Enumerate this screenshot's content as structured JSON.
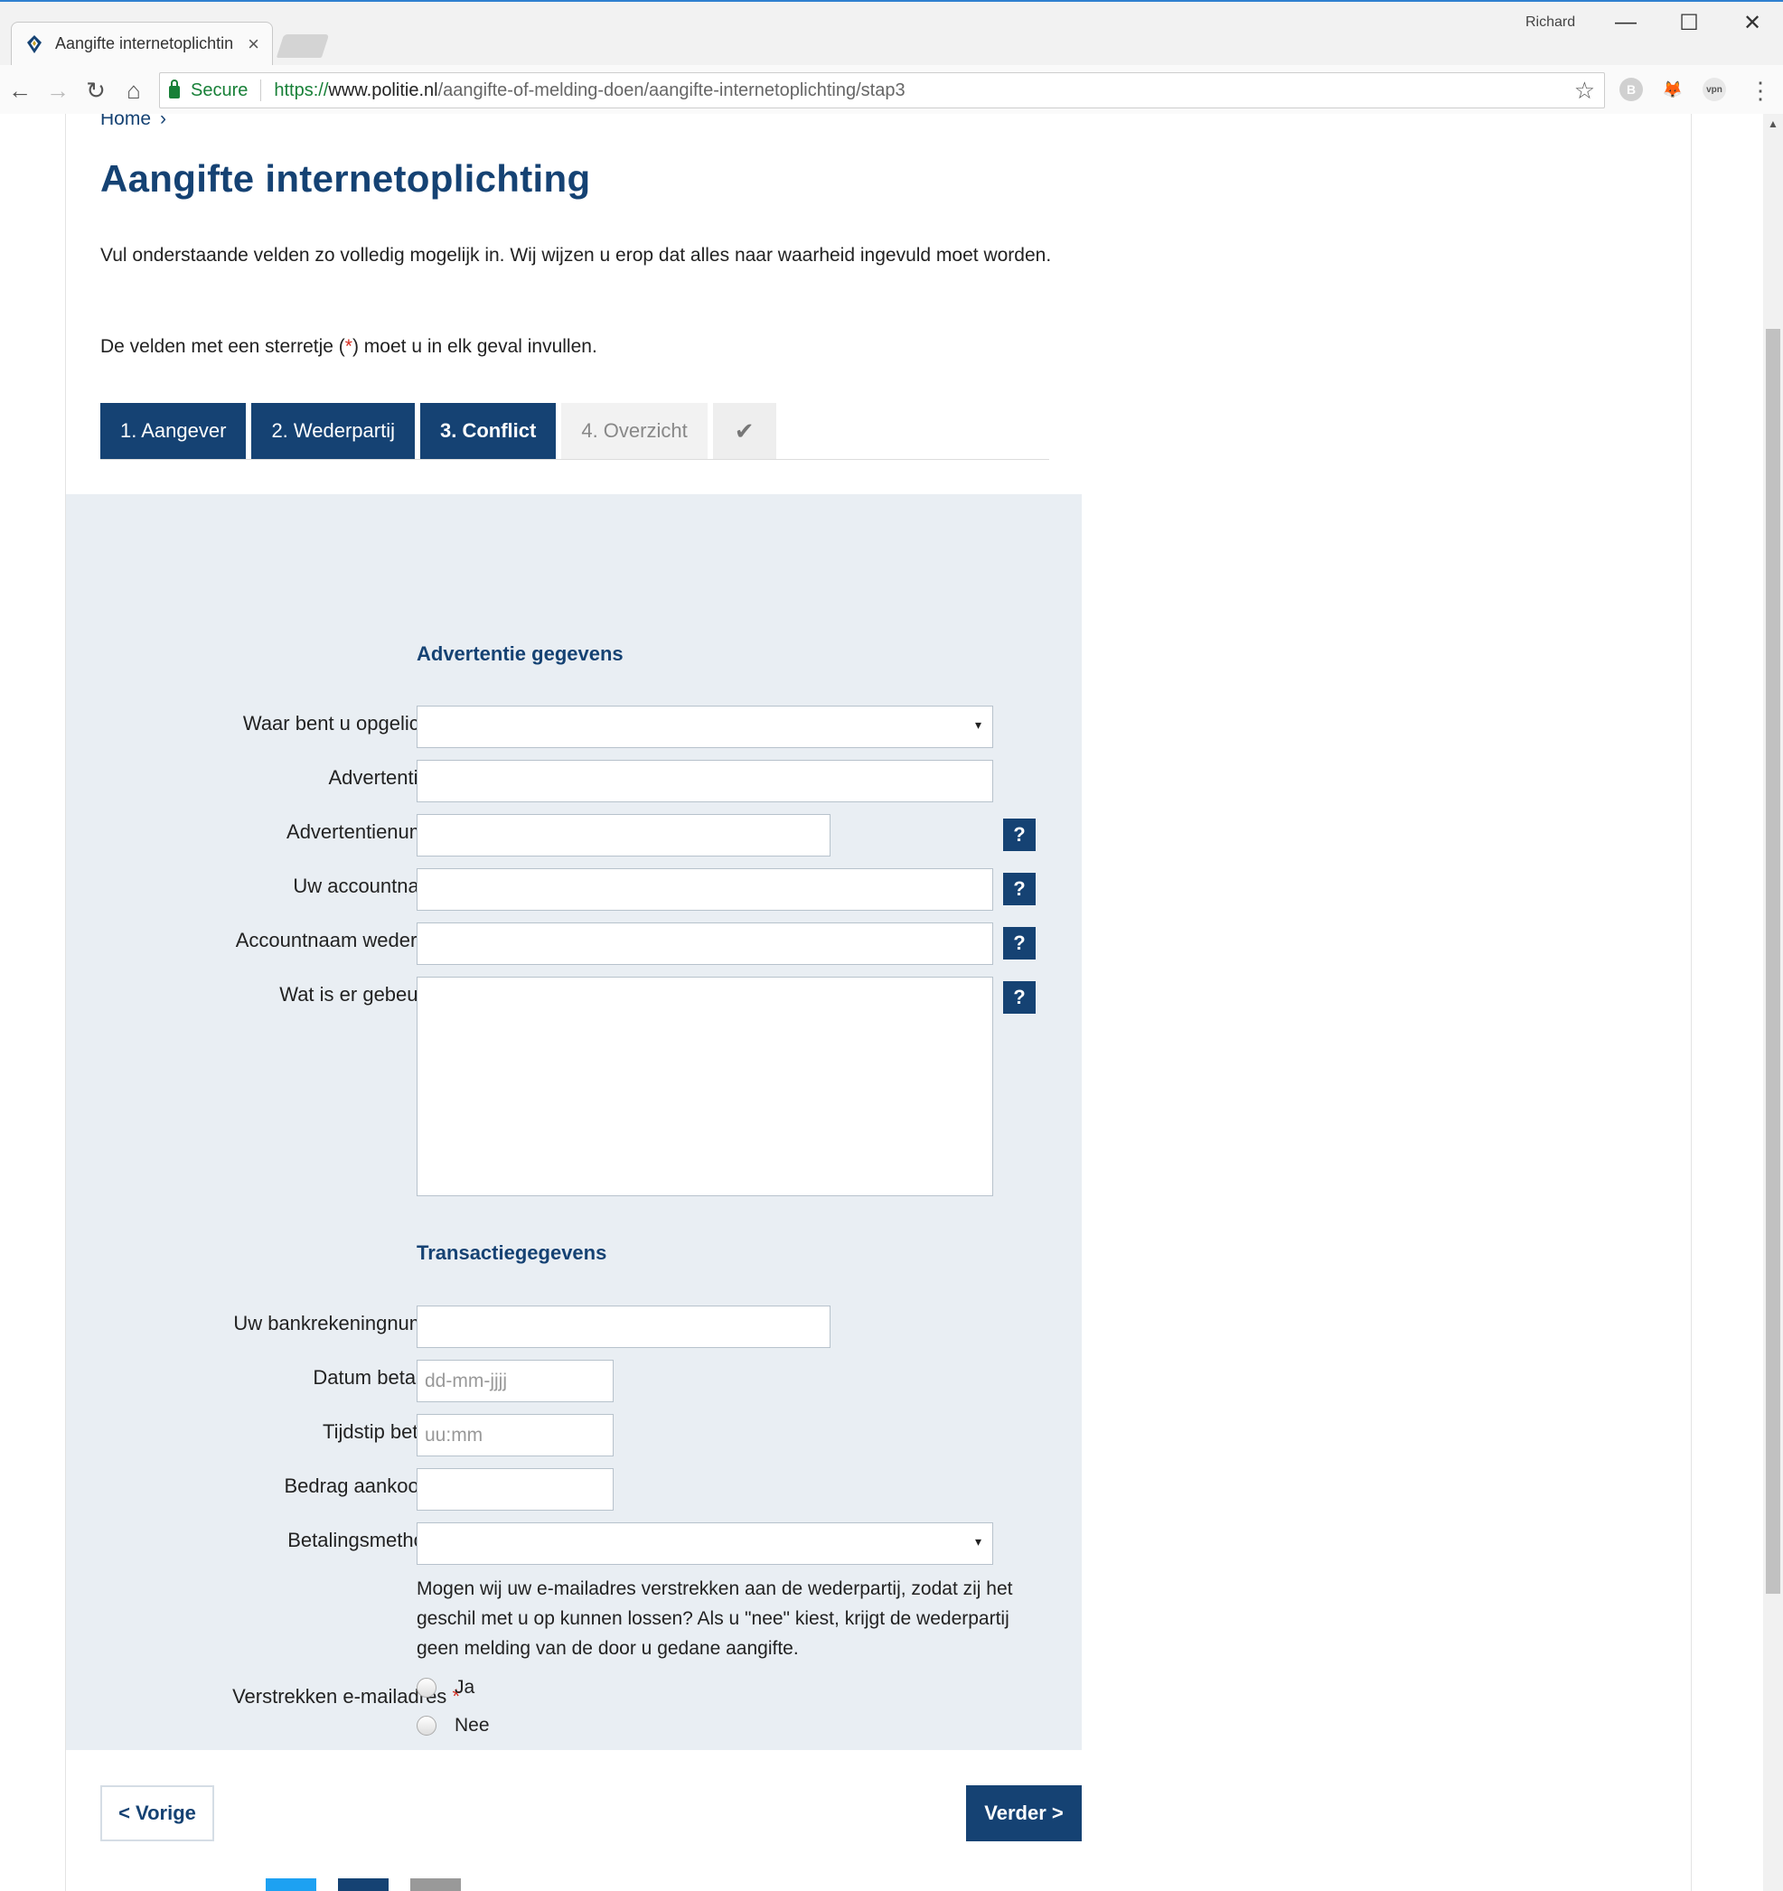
{
  "browser": {
    "tab_title": "Aangifte internetoplichtin",
    "tab_close": "×",
    "profile_name": "Richard",
    "window_controls": {
      "minimize": "—",
      "maximize": "☐",
      "close": "✕"
    },
    "nav": {
      "back": "←",
      "forward": "→",
      "reload": "↻",
      "home": "⌂"
    },
    "secure_label": "Secure",
    "url": {
      "scheme": "https://",
      "host": "www.politie.nl",
      "path": "/aangifte-of-melding-doen/aangifte-internetoplichting/stap3"
    },
    "bookmark_star": "☆",
    "extensions": [
      "B",
      "🦊",
      "vpn"
    ],
    "menu": "⋮"
  },
  "page": {
    "breadcrumb": {
      "home": "Home",
      "separator": "›"
    },
    "title": "Aangifte internetoplichting",
    "intro": "Vul onderstaande velden zo volledig mogelijk in. Wij wijzen u erop dat alles naar waarheid ingevuld moet worden.",
    "required_note": {
      "before": "De velden met een sterretje (",
      "star": "*",
      "after": ") moet u in elk geval invullen."
    },
    "steps": [
      {
        "label": "1. Aangever",
        "state": "done"
      },
      {
        "label": "2. Wederpartij",
        "state": "done"
      },
      {
        "label": "3. Conflict",
        "state": "current"
      },
      {
        "label": "4. Overzicht",
        "state": "todo"
      }
    ],
    "step_check": "✔",
    "sections": {
      "advertentie": "Advertentie gegevens",
      "transactie": "Transactiegegevens"
    },
    "fields": {
      "waar": {
        "label": "Waar bent u opgelicht?",
        "required": "*",
        "value": ""
      },
      "advertentietitel": {
        "label": "Advertentietitel",
        "value": ""
      },
      "advertentienummer": {
        "label": "Advertentienummer",
        "value": ""
      },
      "accountnaam": {
        "label": "Uw accountnaam",
        "required": "*",
        "value": ""
      },
      "accountnaam_wederpartij": {
        "label": "Accountnaam wederpartij",
        "value": ""
      },
      "wat_gebeurd": {
        "label": "Wat is er gebeurd?",
        "required": "*",
        "value": ""
      },
      "bankrekening": {
        "label": "Uw bankrekeningnummer",
        "value": ""
      },
      "datum": {
        "label": "Datum betaling",
        "required": "*",
        "placeholder": "dd-mm-jjjj"
      },
      "tijdstip": {
        "label": "Tijdstip betaling",
        "placeholder": "uu:mm"
      },
      "bedrag": {
        "label": "Bedrag aankoop €",
        "required": "*",
        "value": ""
      },
      "betalingsmethode": {
        "label": "Betalingsmethode",
        "required": "*",
        "value": ""
      },
      "email_text": "Mogen wij uw e-mailadres verstrekken aan de wederpartij, zodat zij het geschil met u op kunnen lossen? Als u \"nee\" kiest, krijgt de wederpartij geen melding van de door u gedane aangifte.",
      "email": {
        "label": "Verstrekken e-mailadres",
        "required": "*",
        "options": [
          "Ja",
          "Nee"
        ]
      }
    },
    "help_label": "?",
    "buttons": {
      "prev": "<  Vorige",
      "next": "Verder >"
    },
    "colors": {
      "brand": "#154273",
      "required": "#d52b1e",
      "panel": "#e9eef3",
      "twitter": "#1da1f2",
      "facebook": "#154273",
      "mail": "#999999"
    }
  }
}
